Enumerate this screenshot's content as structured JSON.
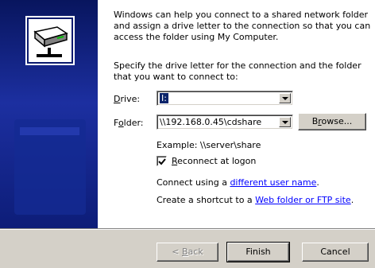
{
  "intro_text": "Windows can help you connect to a shared network folder and assign a drive letter to the connection so that you can access the folder using My Computer.",
  "specify_text": "Specify the drive letter for the connection and the folder that you want to connect to:",
  "drive": {
    "label_mnemonic": "D",
    "label_rest": "rive:",
    "value": "I:"
  },
  "folder": {
    "label_pre": "F",
    "label_mnemonic": "o",
    "label_rest": "lder:",
    "value": "\\\\192.168.0.45\\cdshare"
  },
  "browse_button": {
    "label_pre": "B",
    "label_mnemonic": "r",
    "label_rest": "owse..."
  },
  "example_text": "Example: \\\\server\\share",
  "reconnect": {
    "label_mnemonic": "R",
    "label_rest": "econnect at logon",
    "checked": true
  },
  "connect_using": {
    "prefix": "Connect using a ",
    "link": "different user name",
    "suffix": "."
  },
  "shortcut": {
    "prefix": "Create a shortcut to a ",
    "link": "Web folder or FTP site",
    "suffix": "."
  },
  "footer": {
    "back": {
      "prefix": "< ",
      "mnemonic": "B",
      "rest": "ack"
    },
    "finish": "Finish",
    "cancel": "Cancel"
  },
  "colors": {
    "panel": "#0a1a6e",
    "selection": "#0a246a",
    "link": "#0000ff",
    "face": "#d4d0c8"
  },
  "icons": {
    "drive_icon": "network-drive-icon",
    "dropdown": "chevron-down-icon",
    "check": "checkmark-icon"
  }
}
